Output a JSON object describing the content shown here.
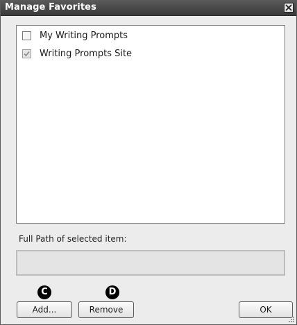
{
  "window": {
    "title": "Manage Favorites"
  },
  "icons": {
    "close": "close-icon",
    "check": "checkmark-icon",
    "grip": "resize-grip-icon"
  },
  "favorites": [
    {
      "label": "My Writing Prompts",
      "checked": false
    },
    {
      "label": "Writing Prompts Site",
      "checked": true
    }
  ],
  "path": {
    "label": "Full Path of selected item:",
    "value": ""
  },
  "buttons": {
    "add": "Add...",
    "remove": "Remove",
    "ok": "OK"
  },
  "callouts": {
    "add": "C",
    "remove": "D"
  }
}
